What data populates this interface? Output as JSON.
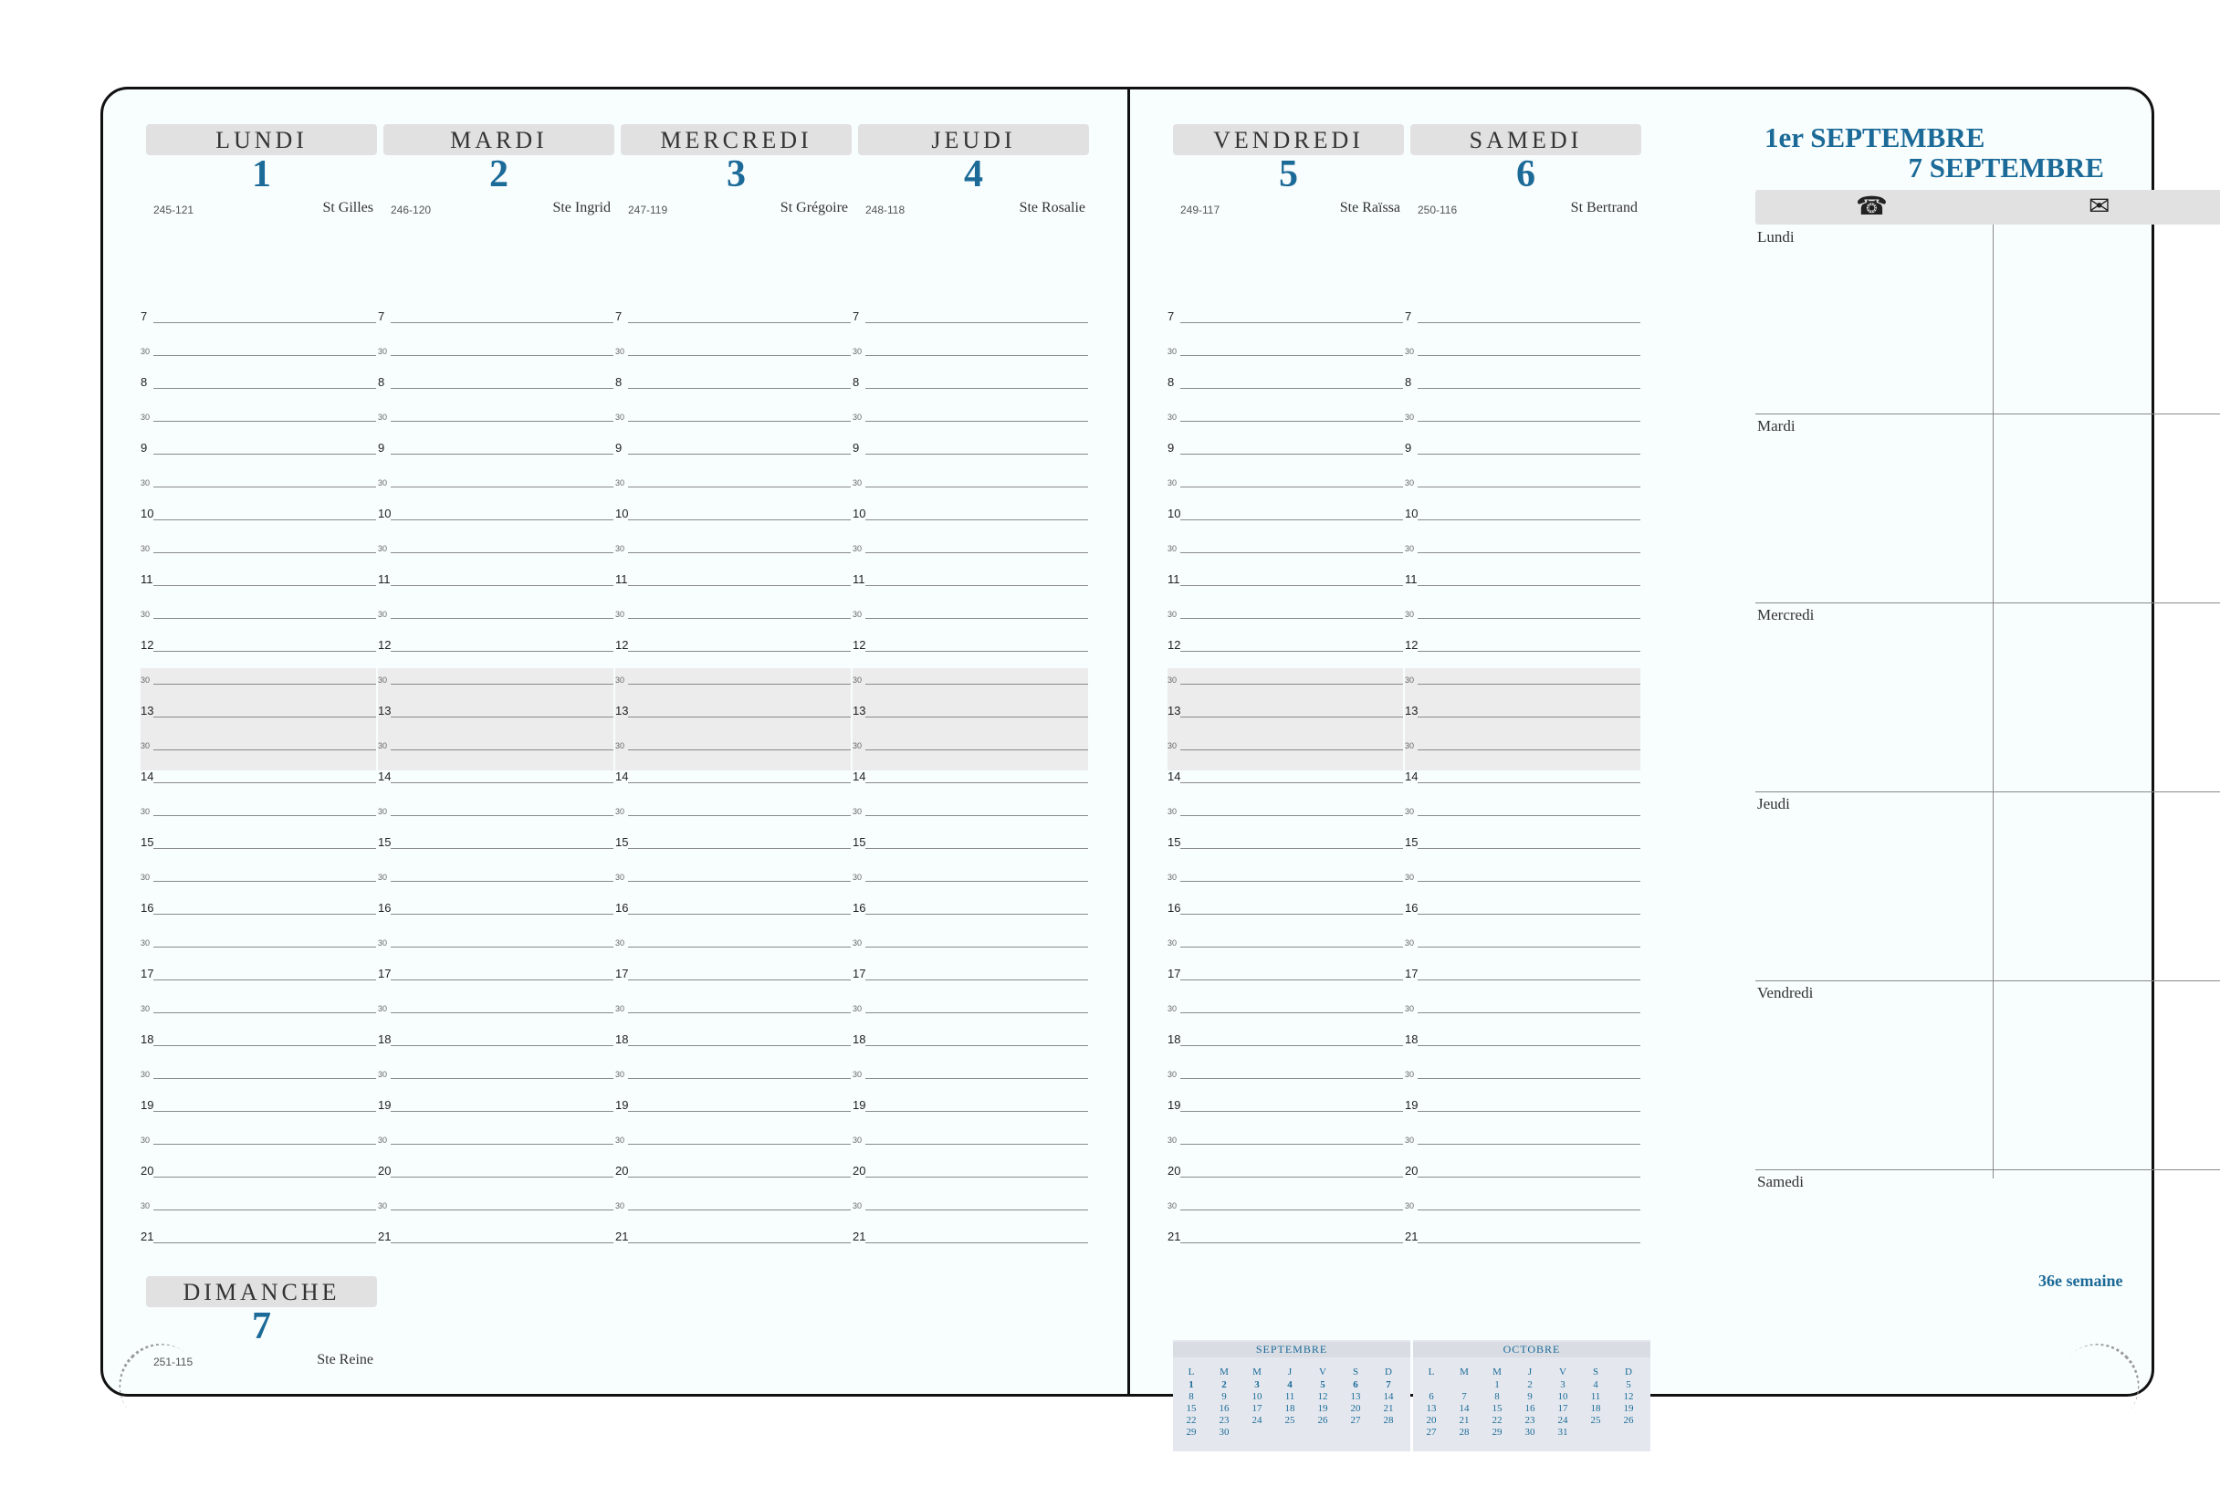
{
  "left_days": [
    {
      "name": "LUNDI",
      "number": "1",
      "code": "245-121",
      "saint": "St Gilles"
    },
    {
      "name": "MARDI",
      "number": "2",
      "code": "246-120",
      "saint": "Ste Ingrid"
    },
    {
      "name": "MERCREDI",
      "number": "3",
      "code": "247-119",
      "saint": "St Grégoire"
    },
    {
      "name": "JEUDI",
      "number": "4",
      "code": "248-118",
      "saint": "Ste Rosalie"
    }
  ],
  "sunday": {
    "name": "DIMANCHE",
    "number": "7",
    "code": "251-115",
    "saint": "Ste Reine"
  },
  "right_days": [
    {
      "name": "VENDREDI",
      "number": "5",
      "code": "249-117",
      "saint": "Ste Raïssa"
    },
    {
      "name": "SAMEDI",
      "number": "6",
      "code": "250-116",
      "saint": "St Bertrand"
    }
  ],
  "hours": [
    "7",
    "30",
    "8",
    "30",
    "9",
    "30",
    "10",
    "30",
    "11",
    "30",
    "12",
    "30",
    "13",
    "30",
    "14",
    "30",
    "15",
    "30",
    "16",
    "30",
    "17",
    "30",
    "18",
    "30",
    "19",
    "30",
    "20",
    "30",
    "21"
  ],
  "week_range": {
    "start": "1er SEPTEMBRE",
    "end": "7 SEPTEMBRE"
  },
  "notes": {
    "phone_icon": "phone-icon",
    "mail_icon": "mail-icon",
    "sections": [
      "Lundi",
      "Mardi",
      "Mercredi",
      "Jeudi",
      "Vendredi",
      "Samedi"
    ],
    "week_label": "36e semaine"
  },
  "mini_calendars": [
    {
      "month": "SEPTEMBRE",
      "weekdays": [
        "L",
        "M",
        "M",
        "J",
        "V",
        "S",
        "D"
      ],
      "weeks": [
        [
          "1",
          "2",
          "3",
          "4",
          "5",
          "6",
          "7"
        ],
        [
          "8",
          "9",
          "10",
          "11",
          "12",
          "13",
          "14"
        ],
        [
          "15",
          "16",
          "17",
          "18",
          "19",
          "20",
          "21"
        ],
        [
          "22",
          "23",
          "24",
          "25",
          "26",
          "27",
          "28"
        ],
        [
          "29",
          "30",
          "",
          "",
          "",
          "",
          ""
        ]
      ]
    },
    {
      "month": "OCTOBRE",
      "weekdays": [
        "L",
        "M",
        "M",
        "J",
        "V",
        "S",
        "D"
      ],
      "weeks": [
        [
          "",
          "",
          "1",
          "2",
          "3",
          "4",
          "5"
        ],
        [
          "6",
          "7",
          "8",
          "9",
          "10",
          "11",
          "12"
        ],
        [
          "13",
          "14",
          "15",
          "16",
          "17",
          "18",
          "19"
        ],
        [
          "20",
          "21",
          "22",
          "23",
          "24",
          "25",
          "26"
        ],
        [
          "27",
          "28",
          "29",
          "30",
          "31",
          "",
          ""
        ]
      ]
    }
  ],
  "colors": {
    "accent": "#1b6a98",
    "lunch_shade": "#ececec",
    "page": "#f8fdfd"
  }
}
